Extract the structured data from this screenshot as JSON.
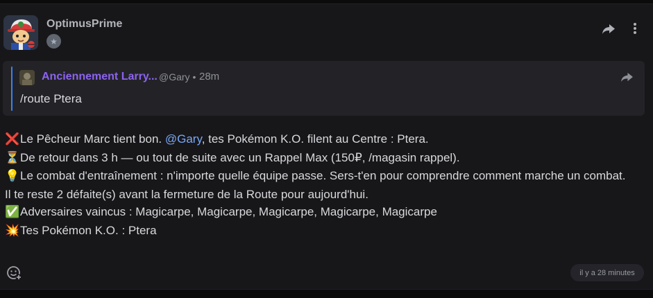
{
  "post": {
    "author": "OptimusPrime",
    "badge_icon": "star-icon",
    "share_icon": "share-icon",
    "more_icon": "more-vertical-icon"
  },
  "quote": {
    "author": "Anciennement Larry...",
    "handle": "@Gary",
    "separator": "•",
    "time": "28m",
    "text": "/route Ptera",
    "accent_color": "#3b82f6",
    "author_color": "#8c63f0"
  },
  "message": {
    "line1_emoji": "❌",
    "line1_pre": "Le Pêcheur Marc tient bon. ",
    "line1_mention": "@Gary",
    "line1_post": ", tes Pokémon K.O. filent au Centre : Ptera.",
    "line2_emoji": "⏳",
    "line2": "De retour dans 3 h — ou tout de suite avec un Rappel Max (150₽, /magasin rappel).",
    "line3_emoji": "💡",
    "line3": "Le combat d'entraînement : n'importe quelle équipe passe. Sers-t'en pour comprendre comment marche un combat.",
    "line4": "Il te reste 2 défaite(s) avant la fermeture de la Route pour aujourd'hui.",
    "line5_emoji": "✅",
    "line5": "Adversaires vaincus : Magicarpe, Magicarpe, Magicarpe, Magicarpe, Magicarpe",
    "line6_emoji": "💥",
    "line6": "Tes Pokémon K.O. : Ptera",
    "mention_color": "#7aa8f7"
  },
  "footer": {
    "react_icon": "add-reaction-icon",
    "timestamp": "il y a 28 minutes"
  }
}
